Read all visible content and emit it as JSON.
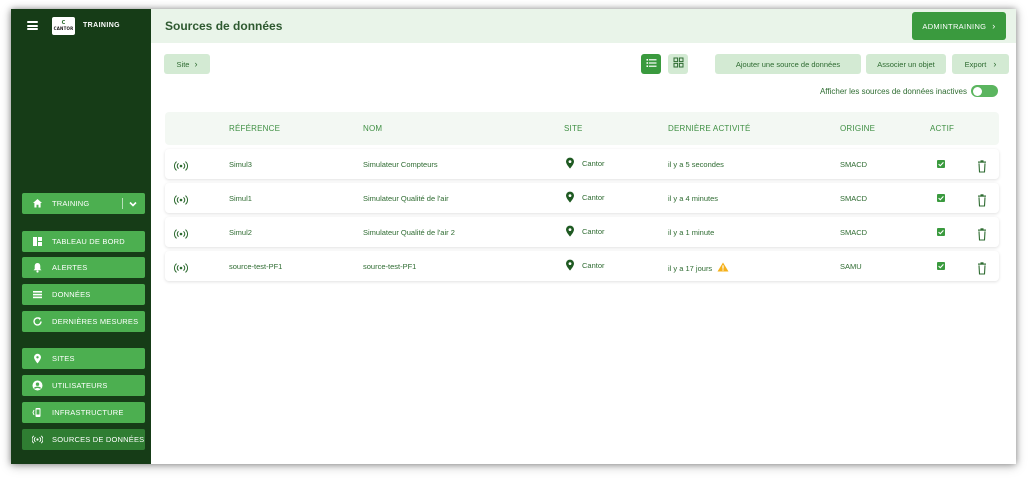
{
  "app": {
    "logo_letter": "C",
    "logo_text": "CANTOR",
    "name": "TRAINING"
  },
  "sidebar": {
    "workspace": {
      "label": "TRAINING",
      "icon": "home-icon"
    },
    "items": [
      {
        "label": "TABLEAU DE BORD",
        "icon": "dashboard-icon"
      },
      {
        "label": "ALERTES",
        "icon": "bell-icon"
      },
      {
        "label": "DONNÉES",
        "icon": "list-icon"
      },
      {
        "label": "DERNIÈRES MESURES",
        "icon": "refresh-icon"
      },
      {
        "label": "SITES",
        "icon": "location-pin-icon"
      },
      {
        "label": "UTILISATEURS",
        "icon": "user-icon"
      },
      {
        "label": "INFRASTRUCTURE",
        "icon": "device-icon"
      },
      {
        "label": "SOURCES DE DONNÉES",
        "icon": "broadcast-icon",
        "active": true
      }
    ]
  },
  "header": {
    "title": "Sources de données",
    "user_button": "ADMINTRAINING"
  },
  "toolbar": {
    "site_filter": "Site",
    "add_source": "Ajouter une source de données",
    "associate": "Associer un objet",
    "export": "Export",
    "show_inactive": "Afficher les sources de données inactives"
  },
  "table": {
    "columns": {
      "reference": "RÉFÉRENCE",
      "name": "NOM",
      "site": "SITE",
      "last_activity": "DERNIÈRE ACTIVITÉ",
      "origin": "ORIGINE",
      "active": "ACTIF"
    },
    "rows": [
      {
        "reference": "Simul3",
        "name": "Simulateur Compteurs",
        "site": "Cantor",
        "last_activity": "il y a 5 secondes",
        "origin": "SMACD",
        "active": true,
        "warning": false
      },
      {
        "reference": "Simul1",
        "name": "Simulateur Qualité de l'air",
        "site": "Cantor",
        "last_activity": "il y a 4 minutes",
        "origin": "SMACD",
        "active": true,
        "warning": false
      },
      {
        "reference": "Simul2",
        "name": "Simulateur Qualité de l'air 2",
        "site": "Cantor",
        "last_activity": "il y a 1 minute",
        "origin": "SMACD",
        "active": true,
        "warning": false
      },
      {
        "reference": "source-test-PF1",
        "name": "source-test-PF1",
        "site": "Cantor",
        "last_activity": "il y a 17 jours",
        "origin": "SAMU",
        "active": true,
        "warning": true
      }
    ]
  },
  "colors": {
    "sidebar_bg": "#163c17",
    "accent": "#3a9a3e",
    "menu_item": "#4caf50",
    "warning": "#f5b01a"
  }
}
